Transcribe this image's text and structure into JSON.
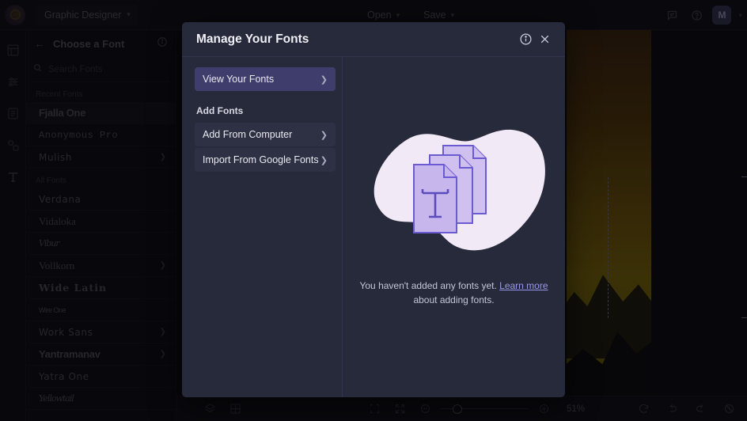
{
  "topbar": {
    "logo_icon": "befunky-logo-icon",
    "document_name": "Graphic Designer",
    "open_label": "Open",
    "save_label": "Save",
    "chat_icon": "chat-bubble-icon",
    "help_icon": "help-circle-icon",
    "avatar_initial": "M"
  },
  "rail": {
    "items": [
      {
        "icon": "templates-icon",
        "name": "sidebar-item-templates"
      },
      {
        "icon": "effects-icon",
        "name": "sidebar-item-effects"
      },
      {
        "icon": "layers-panel-icon",
        "name": "sidebar-item-pages"
      },
      {
        "icon": "elements-icon",
        "name": "sidebar-item-elements"
      },
      {
        "icon": "text-icon",
        "name": "sidebar-item-text"
      }
    ]
  },
  "font_panel": {
    "back_icon": "arrow-left-icon",
    "title": "Choose a Font",
    "info_icon": "info-circle-icon",
    "search_icon": "search-icon",
    "search_placeholder": "Search Fonts",
    "search_value": "",
    "favorite_icon": "star-icon",
    "add_icon": "plus-icon",
    "recent_label": "Recent Fonts",
    "recent_fonts": [
      {
        "name": "Fjalla One",
        "style": "f-cond",
        "highlighted": true,
        "caret": false
      },
      {
        "name": "Anonymous Pro",
        "style": "f-mono",
        "highlighted": false,
        "caret": false
      },
      {
        "name": "Mulish",
        "style": "f-round",
        "highlighted": false,
        "caret": true
      }
    ],
    "all_label": "All Fonts",
    "all_fonts": [
      {
        "name": "Verdana",
        "style": "f-round",
        "caret": false
      },
      {
        "name": "Vidaloka",
        "style": "f-serif",
        "caret": false
      },
      {
        "name": "Vibur",
        "style": "f-script",
        "caret": false
      },
      {
        "name": "Vollkorn",
        "style": "f-serif",
        "caret": true
      },
      {
        "name": "Wide Latin",
        "style": "f-fat",
        "caret": false
      },
      {
        "name": "Wire One",
        "style": "f-thin",
        "caret": false
      },
      {
        "name": "Work Sans",
        "style": "f-round",
        "caret": true
      },
      {
        "name": "Yantramanav",
        "style": "f-cond",
        "caret": true
      },
      {
        "name": "Yatra One",
        "style": "f-round",
        "caret": false
      },
      {
        "name": "Yellowtail",
        "style": "f-script",
        "caret": false
      }
    ]
  },
  "modal": {
    "title": "Manage Your Fonts",
    "info_icon": "info-circle-icon",
    "close_icon": "close-icon",
    "view_fonts_label": "View Your Fonts",
    "add_fonts_label": "Add Fonts",
    "add_from_computer_label": "Add From Computer",
    "import_google_label": "Import From Google Fonts",
    "chevron_icon": "chevron-right-icon",
    "illustration_icon": "font-documents-illustration",
    "empty_text_before": "You haven't added any fonts yet. ",
    "empty_link": "Learn more",
    "empty_text_after": " about adding fonts.",
    "accent_color": "#3f3d6b",
    "background_color": "#272a3a",
    "link_color": "#9b97e8"
  },
  "bottombar": {
    "layers_icon": "layers-icon",
    "grid_icon": "grid-icon",
    "fit_icon": "fit-to-screen-icon",
    "fullscreen_icon": "fullscreen-icon",
    "zoom_out_icon": "zoom-out-icon",
    "zoom_in_icon": "zoom-in-icon",
    "zoom_level": "51%",
    "reset_icon": "reset-icon",
    "undo_icon": "undo-icon",
    "redo_icon": "redo-icon",
    "history_icon": "history-icon"
  }
}
